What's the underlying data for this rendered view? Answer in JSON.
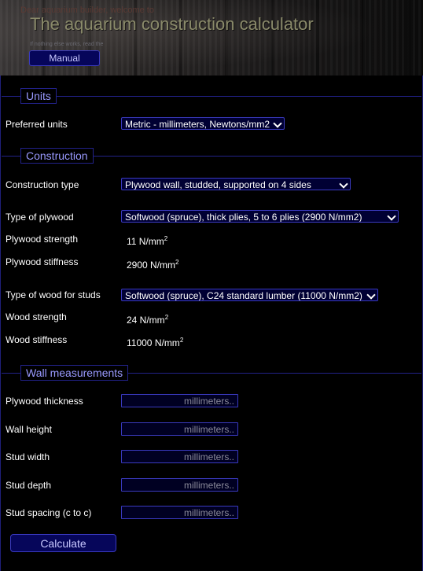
{
  "header": {
    "welcome": "Dear aquarium builder, welcome to",
    "title": "The aquarium construction calculator",
    "hint": "If nothing else works, read the",
    "manual_label": "Manual"
  },
  "sections": {
    "units": "Units",
    "construction": "Construction",
    "wall": "Wall measurements"
  },
  "units": {
    "preferred_label": "Preferred units",
    "preferred_value": "Metric - millimeters, Newtons/mm2"
  },
  "construction": {
    "type_label": "Construction type",
    "type_value": "Plywood wall, studded, supported on 4 sides",
    "plywood_label": "Type of plywood",
    "plywood_value": "Softwood (spruce), thick plies, 5 to 6 plies (2900 N/mm2)",
    "plywood_strength_label": "Plywood strength",
    "plywood_strength_value": "11 N/mm",
    "plywood_stiffness_label": "Plywood stiffness",
    "plywood_stiffness_value": "2900 N/mm",
    "stud_wood_label": "Type of wood for studs",
    "stud_wood_value": "Softwood (spruce), C24 standard lumber (11000 N/mm2)",
    "wood_strength_label": "Wood strength",
    "wood_strength_value": "24 N/mm",
    "wood_stiffness_label": "Wood stiffness",
    "wood_stiffness_value": "11000 N/mm",
    "superscript": "2"
  },
  "wall": {
    "placeholder": "millimeters..",
    "fields": [
      {
        "label": "Plywood thickness",
        "value": ""
      },
      {
        "label": "Wall height",
        "value": ""
      },
      {
        "label": "Stud width",
        "value": ""
      },
      {
        "label": "Stud depth",
        "value": ""
      },
      {
        "label": "Stud spacing (c to c)",
        "value": ""
      }
    ]
  },
  "calculate_label": "Calculate",
  "colors": {
    "background": "#000000",
    "accent_border": "#3a3ac0",
    "section_text": "#9a9aff",
    "button_bg": "#06065a"
  }
}
